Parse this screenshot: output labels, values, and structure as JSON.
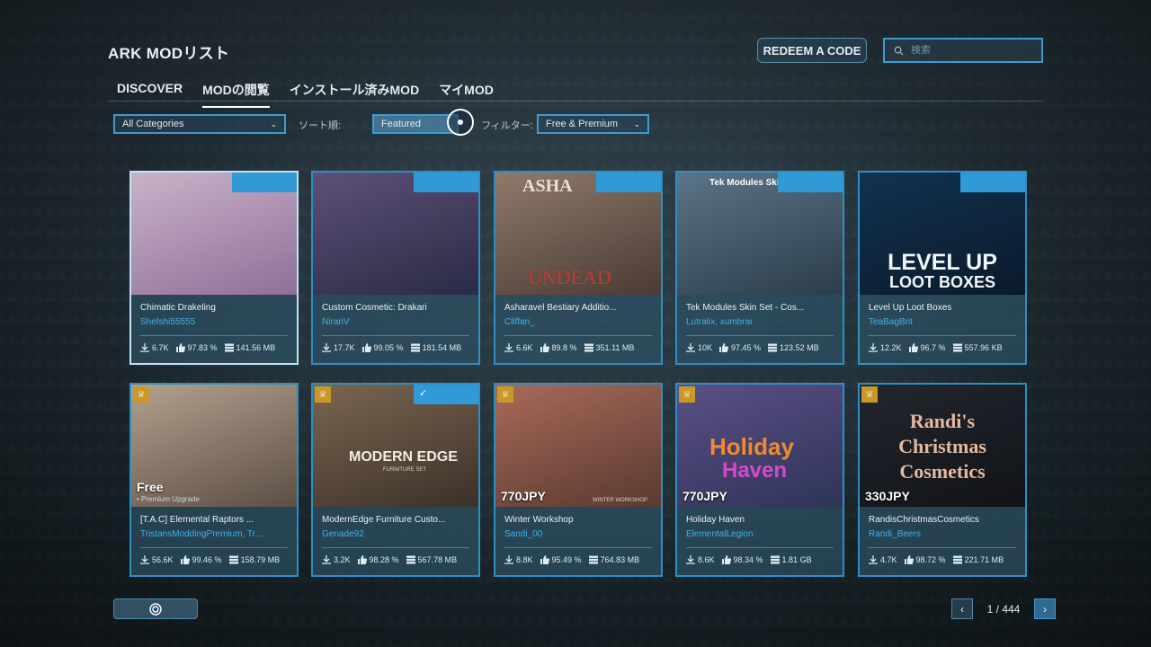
{
  "app": {
    "title": "ARK MODリスト"
  },
  "header": {
    "redeem_label": "REDEEM A CODE",
    "search_placeholder": "検索"
  },
  "tabs": [
    {
      "label": "DISCOVER"
    },
    {
      "label": "MODの閲覧"
    },
    {
      "label": "インストール済みMOD"
    },
    {
      "label": "マイMOD"
    }
  ],
  "filters": {
    "category": "All Categories",
    "sort_label": "ソート順:",
    "sort_value": "Featured",
    "filter_label": "フィルター:",
    "filter_value": "Free & Premium"
  },
  "mods": [
    {
      "name": "Chimatic Drakeling",
      "author": "Shefshi55555",
      "downloads": "6.7K",
      "rating": "97.83 %",
      "size": "141.56 MB",
      "price": "",
      "premium": false,
      "installed": false,
      "selected": true,
      "bg": [
        "#c9b3c8",
        "#8f6f99"
      ]
    },
    {
      "name": "Custom Cosmetic: Drakari",
      "author": "NiranV",
      "downloads": "17.7K",
      "rating": "99.05 %",
      "size": "181.54 MB",
      "price": "",
      "premium": false,
      "installed": false,
      "selected": false,
      "bg": [
        "#5d5078",
        "#2a2b45"
      ]
    },
    {
      "name": "Asharavel Bestiary Additio...",
      "author": "Cliffan_",
      "downloads": "6.6K",
      "rating": "89.8 %",
      "size": "351.11 MB",
      "price": "",
      "premium": false,
      "installed": false,
      "selected": false,
      "bg": [
        "#8e7a6a",
        "#4a3b34"
      ]
    },
    {
      "name": "Tek Modules Skin Set - Cos...",
      "author": "Lutralix, xumbrai",
      "downloads": "10K",
      "rating": "97.45 %",
      "size": "123.52 MB",
      "price": "",
      "premium": false,
      "installed": false,
      "selected": false,
      "bg": [
        "#5c7487",
        "#2c3d4a"
      ]
    },
    {
      "name": "Level Up Loot Boxes",
      "author": "TeaBagBrit",
      "downloads": "12.2K",
      "rating": "96.7 %",
      "size": "557.96 KB",
      "price": "",
      "premium": false,
      "installed": false,
      "selected": false,
      "bg": [
        "#12324f",
        "#0a1a2c"
      ]
    },
    {
      "name": "[T.A.C] Elemental Raptors ...",
      "author": "TristansModdingPremium, Tr...",
      "downloads": "56.6K",
      "rating": "99.46 %",
      "size": "158.79 MB",
      "price": "Free",
      "price_sub": "• Premium Upgrade",
      "premium": true,
      "installed": false,
      "selected": false,
      "bg": [
        "#b3a08e",
        "#5d4f45"
      ]
    },
    {
      "name": "ModernEdge Furniture Custo...",
      "author": "Genade92",
      "downloads": "3.2K",
      "rating": "98.28 %",
      "size": "567.78 MB",
      "price": "",
      "premium": true,
      "installed": true,
      "selected": false,
      "bg": [
        "#7a6651",
        "#3c3128"
      ]
    },
    {
      "name": "Winter Workshop",
      "author": "Sandi_00",
      "downloads": "8.8K",
      "rating": "95.49 %",
      "size": "764.83 MB",
      "price": "770JPY",
      "premium": true,
      "installed": false,
      "selected": false,
      "bg": [
        "#a86a5a",
        "#5a3a2f"
      ]
    },
    {
      "name": "Holiday Haven",
      "author": "ElementalLegion",
      "downloads": "8.6K",
      "rating": "98.34 %",
      "size": "1.81 GB",
      "price": "770JPY",
      "premium": true,
      "installed": false,
      "selected": false,
      "bg": [
        "#5b4f86",
        "#2e3458"
      ]
    },
    {
      "name": "RandisChristmasCosmetics",
      "author": "Randi_Beers",
      "downloads": "4.7K",
      "rating": "98.72 %",
      "size": "221.71 MB",
      "price": "330JPY",
      "premium": true,
      "installed": false,
      "selected": false,
      "bg": [
        "#23262e",
        "#111318"
      ]
    }
  ],
  "thumb_text": {
    "m2_a": "ASHA",
    "m2_b": "UNDEAD",
    "m3": "Tek Modules Skin Set",
    "m4_a": "LEVEL UP",
    "m4_b": "LOOT BOXES",
    "m6_a": "MODERN EDGE",
    "m6_b": "FURNITURE SET",
    "m7": "WINTER WORKSHOP",
    "m8_a": "Holiday",
    "m8_b": "Haven",
    "m9_a": "Randi's",
    "m9_b": "Christmas",
    "m9_c": "Cosmetics"
  },
  "pagination": {
    "current": "1 / 444"
  }
}
